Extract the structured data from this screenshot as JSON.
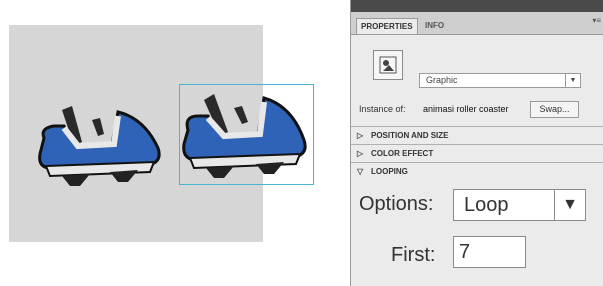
{
  "properties_panel": {
    "tabs": [
      "PROPERTIES",
      "INFO"
    ],
    "symbol_type": "Graphic",
    "instance_label": "Instance of:",
    "instance_name": "animasi roller coaster",
    "swap_button": "Swap...",
    "sections": [
      "POSITION AND SIZE",
      "COLOR EFFECT",
      "LOOPING"
    ],
    "options_label": "Options:",
    "options_value": "Loop",
    "first_label": "First:",
    "first_value": "7"
  },
  "colors": {
    "car_blue": "#2f63b8",
    "selection": "#4ab3d6",
    "stage_bg": "#d6d6d6"
  },
  "icons": {
    "symbol": "graphic-symbol-icon",
    "dropdown": "triangle-down-icon",
    "collapsed": "triangle-right-icon",
    "expanded": "triangle-down-icon"
  }
}
